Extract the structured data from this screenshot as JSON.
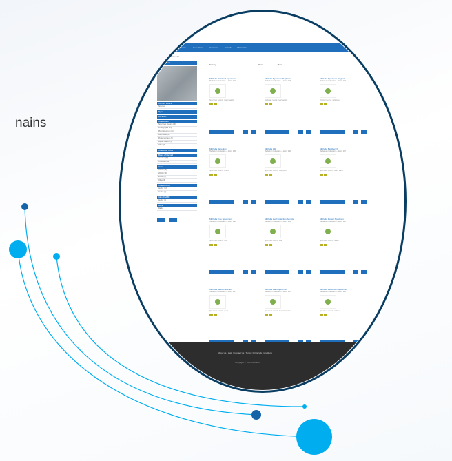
{
  "background": {
    "partial_text": "nains"
  },
  "colors": {
    "brand": "#1f6fbd",
    "ring": "#0a3d62",
    "accent": "#00aeef",
    "footer": "#2d2d2d"
  },
  "app": {
    "nav": {
      "logo_text": "Logo",
      "items": [
        "Home",
        "Collections",
        "Compare",
        "Search",
        "Information"
      ],
      "right": [
        "Log in",
        "Register"
      ]
    },
    "breadcrumb": "Home / Search / Results",
    "sidebar": {
      "search_head": "Search Tools",
      "sections": [
        {
          "head": "Current Filters",
          "rows": [
            "Species"
          ]
        },
        {
          "head": "Type",
          "rows": []
        },
        {
          "head": "Location",
          "rows": []
        },
        {
          "head": "Collections",
          "rows": [
            "Specimen Record (23)",
            "Photographs (15)",
            "Plant Specimen (11)",
            "Field Notes (8)",
            "Preserved Item (6)",
            "Digital Images (4)",
            "Other (2)"
          ]
        },
        {
          "head": "Collection Code",
          "rows": []
        },
        {
          "head": "Basis of Record",
          "rows": [
            "Voucher (30)",
            "Observed (12)"
          ]
        },
        {
          "head": "Year",
          "rows": [
            "1990s (16)",
            "2000s (14)",
            "2010s (9)",
            "Other (3)"
          ]
        },
        {
          "head": "Collected By",
          "rows": [
            "Author (13)",
            "Author (7)"
          ]
        },
        {
          "head": "Identified By",
          "rows": [
            "Author (5)"
          ]
        },
        {
          "head": "Rank",
          "rows": [
            "Rank"
          ]
        }
      ],
      "buttons": [
        "Apply",
        "Reset"
      ]
    },
    "filters": {
      "sort_label": "Sort by",
      "show_label": "Show",
      "view_label": "View"
    },
    "cards": [
      {
        "title": "Michelia Mainland Specimen",
        "sub": "Herbarium Collection — Entry 102",
        "desc": "Specimen record · plant material"
      },
      {
        "title": "Michelia Specimen Duplicate",
        "sub": "Herbarium Collection — Entry 103",
        "desc": "Duplicate record · leaf sample"
      },
      {
        "title": "Michelia Specimen Original",
        "sub": "Herbarium Collection — Entry 104",
        "desc": "Original record · field note"
      },
      {
        "title": "Michelia Bioregion",
        "sub": "Herbarium Collection — Entry 105",
        "desc": "Specimen record · branch"
      },
      {
        "title": "Michelia Hill",
        "sub": "Herbarium Collection — Entry 106",
        "desc": "Specimen record · seed pod"
      },
      {
        "title": "Michelia Biodiversity",
        "sub": "Herbarium Collection — Entry 107",
        "desc": "Specimen record · blank sheet"
      },
      {
        "title": "Michelia Tree Specimen",
        "sub": "Herbarium Collection — Entry 108",
        "desc": "Specimen record · fruit"
      },
      {
        "title": "Michelia Leaf Collection Sample",
        "sub": "Herbarium Collection — Entry 109",
        "desc": "Specimen record · leaf"
      },
      {
        "title": "Michelia Flower Specimen",
        "sub": "Herbarium Collection — Entry 110",
        "desc": "Specimen record · flower"
      },
      {
        "title": "Michelia Seed Collection",
        "sub": "Herbarium Collection — Entry 111",
        "desc": "Specimen record · seed"
      },
      {
        "title": "Michelia Plant Specimen",
        "sub": "Herbarium Collection — Entry 112",
        "desc": "Specimen record · herbarium sheet"
      },
      {
        "title": "Michelia Herbarium Specimen",
        "sub": "Herbarium Collection — Entry 113",
        "desc": "Specimen record · archive"
      }
    ],
    "pager": [
      "1",
      "2",
      "3",
      "4",
      "5",
      "6",
      "Next",
      "Last"
    ],
    "footer": {
      "links": "About Us  |  Help  |  Contact Us  |  Terms  |  Privacy & Conditions",
      "copyright": "Copyright © Your Institution"
    }
  }
}
